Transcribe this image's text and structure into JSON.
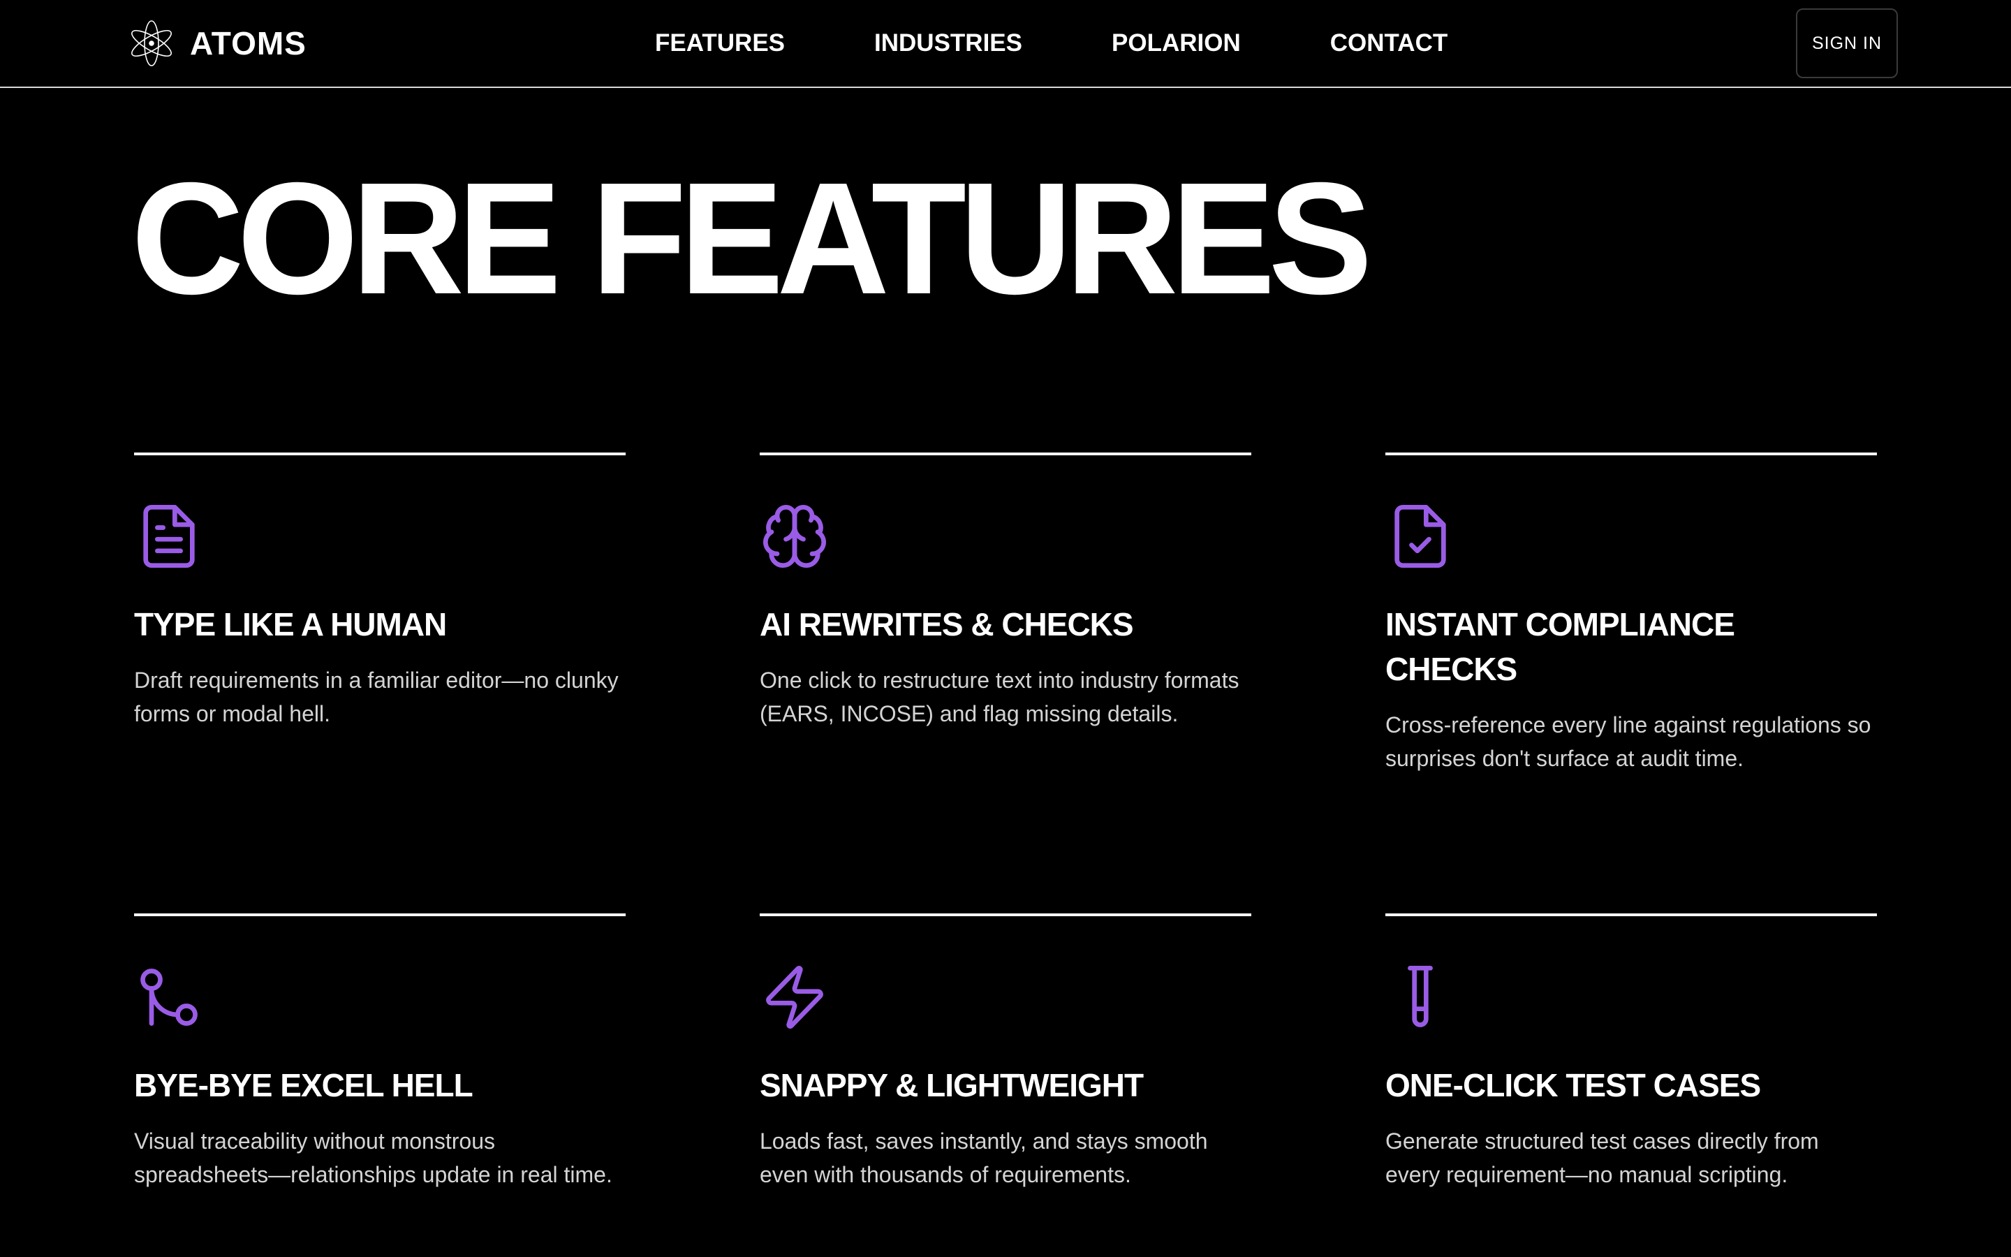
{
  "header": {
    "brand": {
      "name": "ATOMS",
      "logo_icon": "atom-icon"
    },
    "nav": [
      {
        "label": "FEATURES"
      },
      {
        "label": "INDUSTRIES"
      },
      {
        "label": "POLARION"
      },
      {
        "label": "CONTACT"
      }
    ],
    "signin_label": "SIGN IN"
  },
  "main": {
    "title": "CORE FEATURES",
    "features": [
      {
        "icon": "document-icon",
        "title": "TYPE LIKE A HUMAN",
        "description": "Draft requirements in a familiar editor—no clunky forms or modal hell."
      },
      {
        "icon": "brain-icon",
        "title": "AI REWRITES & CHECKS",
        "description": "One click to restructure text into industry formats (EARS, INCOSE) and flag missing details."
      },
      {
        "icon": "file-check-icon",
        "title": "INSTANT COMPLIANCE CHECKS",
        "description": "Cross-reference every line against regulations so surprises don't surface at audit time."
      },
      {
        "icon": "git-merge-icon",
        "title": "BYE-BYE EXCEL HELL",
        "description": "Visual traceability without monstrous spreadsheets—relationships update in real time."
      },
      {
        "icon": "lightning-icon",
        "title": "SNAPPY & LIGHTWEIGHT",
        "description": "Loads fast, saves instantly, and stays smooth even with thousands of requirements."
      },
      {
        "icon": "test-tube-icon",
        "title": "ONE-CLICK TEST CASES",
        "description": "Generate structured test cases directly from every requirement—no manual scripting."
      }
    ]
  },
  "colors": {
    "background": "#000000",
    "text": "#ffffff",
    "muted_text": "#d4d4d4",
    "accent": "#9a5ce6",
    "divider": "#ffffff"
  }
}
